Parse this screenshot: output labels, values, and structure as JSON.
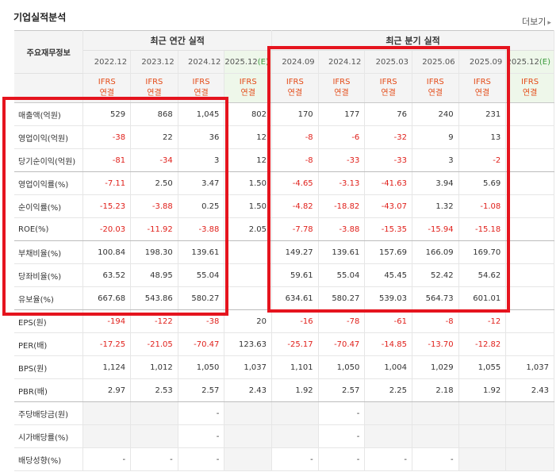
{
  "header": {
    "title": "기업실적분석",
    "more_label": "더보기"
  },
  "table": {
    "corner_label": "주요재무정보",
    "groups": {
      "annual": "최근 연간 실적",
      "quarterly": "최근 분기 실적"
    },
    "periods": [
      "2022.12",
      "2023.12",
      "2024.12",
      "2025.12(E)",
      "2024.09",
      "2024.12",
      "2025.03",
      "2025.06",
      "2025.09",
      "2025.12(E)"
    ],
    "std_line1": "IFRS",
    "std_line2": "연결",
    "rows": [
      {
        "label": "매출액(억원)",
        "values": [
          "529",
          "868",
          "1,045",
          "802",
          "170",
          "177",
          "76",
          "240",
          "231",
          ""
        ]
      },
      {
        "label": "영업이익(억원)",
        "values": [
          "-38",
          "22",
          "36",
          "12",
          "-8",
          "-6",
          "-32",
          "9",
          "13",
          ""
        ]
      },
      {
        "label": "당기순이익(억원)",
        "values": [
          "-81",
          "-34",
          "3",
          "12",
          "-8",
          "-33",
          "-33",
          "3",
          "-2",
          ""
        ]
      },
      {
        "label": "영업이익률(%)",
        "values": [
          "-7.11",
          "2.50",
          "3.47",
          "1.50",
          "-4.65",
          "-3.13",
          "-41.63",
          "3.94",
          "5.69",
          ""
        ]
      },
      {
        "label": "순이익률(%)",
        "values": [
          "-15.23",
          "-3.88",
          "0.25",
          "1.50",
          "-4.82",
          "-18.82",
          "-43.07",
          "1.32",
          "-1.08",
          ""
        ]
      },
      {
        "label": "ROE(%)",
        "values": [
          "-20.03",
          "-11.92",
          "-3.88",
          "2.05",
          "-7.78",
          "-3.88",
          "-15.35",
          "-15.94",
          "-15.18",
          ""
        ]
      },
      {
        "label": "부채비율(%)",
        "values": [
          "100.84",
          "198.30",
          "139.61",
          "",
          "149.27",
          "139.61",
          "157.69",
          "166.09",
          "169.70",
          ""
        ]
      },
      {
        "label": "당좌비율(%)",
        "values": [
          "63.52",
          "48.95",
          "55.04",
          "",
          "59.61",
          "55.04",
          "45.45",
          "52.42",
          "54.62",
          ""
        ]
      },
      {
        "label": "유보율(%)",
        "values": [
          "667.68",
          "543.86",
          "580.27",
          "",
          "634.61",
          "580.27",
          "539.03",
          "564.73",
          "601.01",
          ""
        ]
      },
      {
        "label": "EPS(원)",
        "values": [
          "-194",
          "-122",
          "-38",
          "20",
          "-16",
          "-78",
          "-61",
          "-8",
          "-12",
          ""
        ]
      },
      {
        "label": "PER(배)",
        "values": [
          "-17.25",
          "-21.05",
          "-70.47",
          "123.63",
          "-25.17",
          "-70.47",
          "-14.85",
          "-13.70",
          "-12.82",
          ""
        ]
      },
      {
        "label": "BPS(원)",
        "values": [
          "1,124",
          "1,012",
          "1,050",
          "1,037",
          "1,101",
          "1,050",
          "1,004",
          "1,029",
          "1,055",
          "1,037"
        ]
      },
      {
        "label": "PBR(배)",
        "values": [
          "2.97",
          "2.53",
          "2.57",
          "2.43",
          "1.92",
          "2.57",
          "2.25",
          "2.18",
          "1.92",
          "2.43"
        ]
      },
      {
        "label": "주당배당금(원)",
        "values": [
          "",
          "",
          "-",
          "",
          "",
          "-",
          "",
          "",
          "",
          ""
        ]
      },
      {
        "label": "시가배당률(%)",
        "values": [
          "",
          "",
          "-",
          "",
          "",
          "-",
          "",
          "",
          "",
          ""
        ]
      },
      {
        "label": "배당성향(%)",
        "values": [
          "-",
          "-",
          "-",
          "",
          "-",
          "-",
          "-",
          "-",
          "",
          ""
        ]
      }
    ]
  },
  "colors": {
    "highlight_box": "#e5141e",
    "negative": "#e0201b",
    "standard_label": "#e44c19",
    "estimate_bg": "#eef7ea"
  }
}
